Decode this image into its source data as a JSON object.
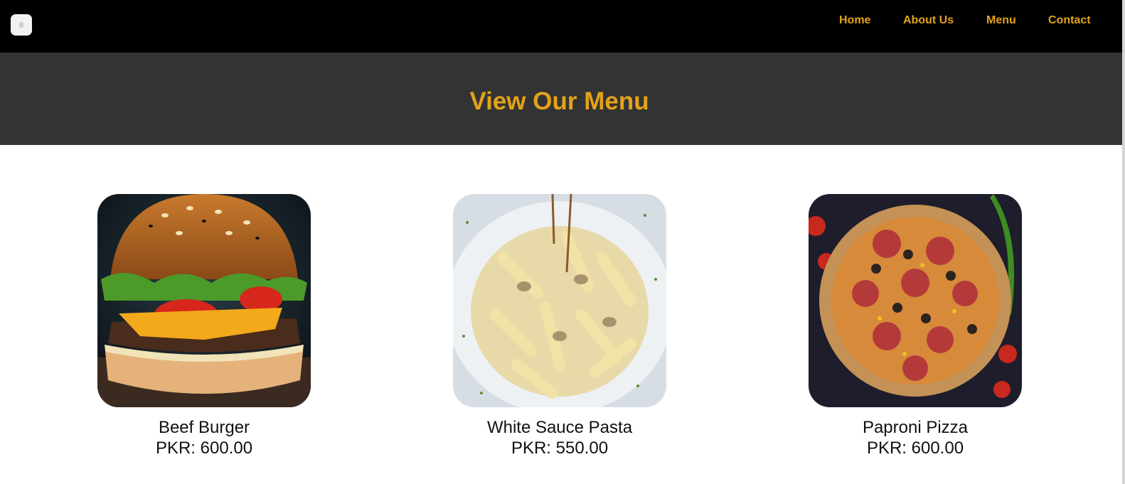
{
  "nav": {
    "links": [
      "Home",
      "About Us",
      "Menu",
      "Contact"
    ],
    "accent_color": "#e3a21a",
    "logo_icon": "logo-icon"
  },
  "hero": {
    "title": "View Our Menu"
  },
  "menu": {
    "items": [
      {
        "name": "Beef Burger",
        "price": "PKR: 600.00",
        "image": "burger-photo"
      },
      {
        "name": "White Sauce Pasta",
        "price": "PKR: 550.00",
        "image": "pasta-photo"
      },
      {
        "name": "Paproni Pizza",
        "price": "PKR: 600.00",
        "image": "pizza-photo"
      }
    ]
  }
}
